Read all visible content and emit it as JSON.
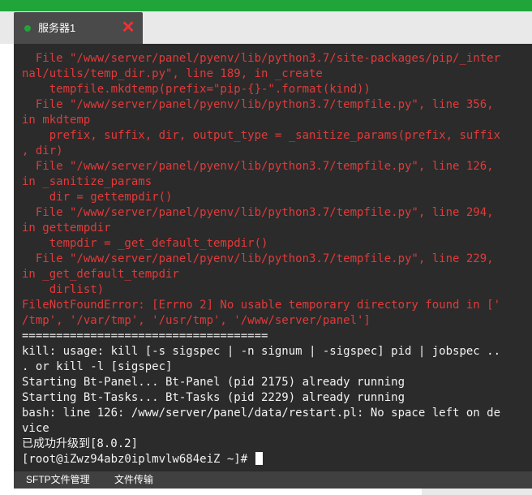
{
  "tab": {
    "label": "服务器1",
    "status_color": "#20a53a",
    "close_icon": "close-icon"
  },
  "terminal": {
    "lines": [
      {
        "text": "  File \"/www/server/panel/pyenv/lib/python3.7/site-packages/pip/_inter",
        "style": "err"
      },
      {
        "text": "nal/utils/temp_dir.py\", line 189, in _create",
        "style": "err"
      },
      {
        "text": "    tempfile.mkdtemp(prefix=\"pip-{}-\".format(kind))",
        "style": "err"
      },
      {
        "text": "  File \"/www/server/panel/pyenv/lib/python3.7/tempfile.py\", line 356,",
        "style": "err"
      },
      {
        "text": "in mkdtemp",
        "style": "err"
      },
      {
        "text": "    prefix, suffix, dir, output_type = _sanitize_params(prefix, suffix",
        "style": "err"
      },
      {
        "text": ", dir)",
        "style": "err"
      },
      {
        "text": "  File \"/www/server/panel/pyenv/lib/python3.7/tempfile.py\", line 126,",
        "style": "err"
      },
      {
        "text": "in _sanitize_params",
        "style": "err"
      },
      {
        "text": "    dir = gettempdir()",
        "style": "err"
      },
      {
        "text": "  File \"/www/server/panel/pyenv/lib/python3.7/tempfile.py\", line 294,",
        "style": "err"
      },
      {
        "text": "in gettempdir",
        "style": "err"
      },
      {
        "text": "    tempdir = _get_default_tempdir()",
        "style": "err"
      },
      {
        "text": "  File \"/www/server/panel/pyenv/lib/python3.7/tempfile.py\", line 229,",
        "style": "err"
      },
      {
        "text": "in _get_default_tempdir",
        "style": "err"
      },
      {
        "text": "    dirlist)",
        "style": "err"
      },
      {
        "text": "FileNotFoundError: [Errno 2] No usable temporary directory found in ['",
        "style": "err"
      },
      {
        "text": "/tmp', '/var/tmp', '/usr/tmp', '/www/server/panel']",
        "style": "err"
      },
      {
        "text": "====================================",
        "style": "norm"
      },
      {
        "text": "kill: usage: kill [-s sigspec | -n signum | -sigspec] pid | jobspec ..",
        "style": "norm"
      },
      {
        "text": ". or kill -l [sigspec]",
        "style": "norm"
      },
      {
        "text": "Starting Bt-Panel... Bt-Panel (pid 2175) already running",
        "style": "norm"
      },
      {
        "text": "Starting Bt-Tasks... Bt-Tasks (pid 2229) already running",
        "style": "norm"
      },
      {
        "text": "bash: line 126: /www/server/panel/data/restart.pl: No space left on de",
        "style": "norm"
      },
      {
        "text": "vice",
        "style": "norm"
      },
      {
        "text": "已成功升级到[8.0.2]",
        "style": "norm"
      }
    ],
    "prompt": "[root@iZwz94abz0iplmvlw684eiZ ~]# ",
    "error_color": "#e23a3a",
    "text_color": "#f2f2f2",
    "background": "#2b2b2b"
  },
  "footer": {
    "sftp_label": "SFTP文件管理",
    "transfer_label": "文件传输"
  }
}
